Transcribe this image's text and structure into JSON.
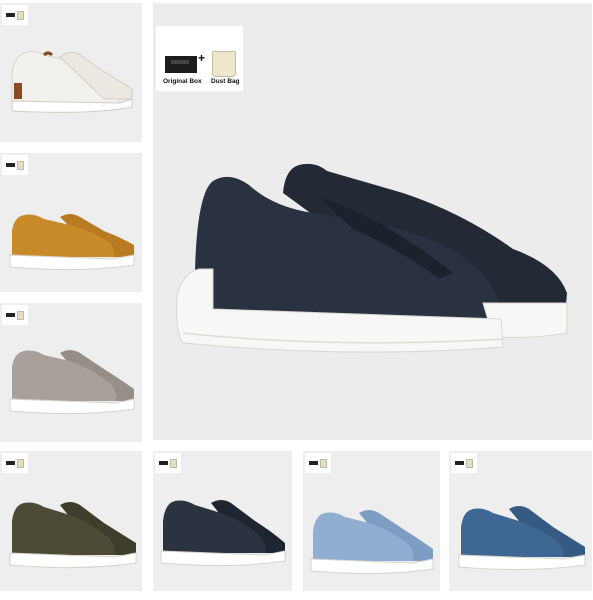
{
  "thumbnails": [
    {
      "name": "white-sneaker"
    },
    {
      "name": "tan-suede-sneaker"
    },
    {
      "name": "grey-suede-sneaker"
    }
  ],
  "bottom_row": [
    {
      "name": "olive-suede-sneaker"
    },
    {
      "name": "navy-leather-sneaker"
    },
    {
      "name": "light-blue-suede-sneaker"
    },
    {
      "name": "blue-suede-sneaker"
    }
  ],
  "main": {
    "box_label": "Original Box",
    "bag_label": "Dust Bag",
    "plus_sign": "+"
  },
  "colors": {
    "white": "#f2f0ec",
    "tan": "#c98a2a",
    "grey": "#a59e98",
    "olive": "#4d4a35",
    "navy": "#2c3340",
    "light_blue": "#8faed2",
    "blue": "#3f6793",
    "main_navy": "#2a3140"
  }
}
